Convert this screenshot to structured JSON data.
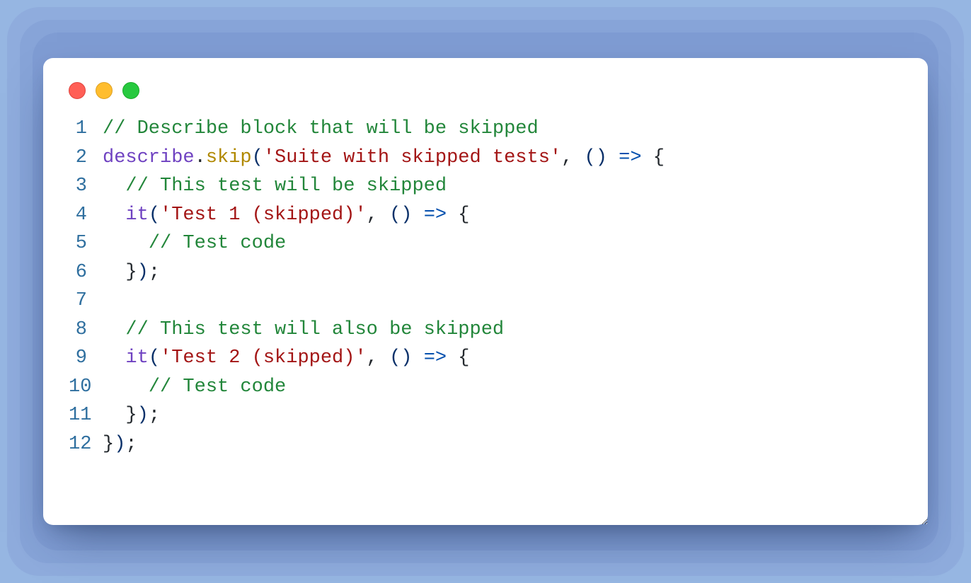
{
  "window": {
    "traffic": [
      "close",
      "minimize",
      "zoom"
    ]
  },
  "code": {
    "lines": [
      {
        "n": "1",
        "tokens": [
          {
            "cls": "c-comment",
            "t": "// Describe block that will be skipped"
          }
        ]
      },
      {
        "n": "2",
        "tokens": [
          {
            "cls": "c-call",
            "t": "describe"
          },
          {
            "cls": "c-punc",
            "t": "."
          },
          {
            "cls": "c-skip",
            "t": "skip"
          },
          {
            "cls": "c-paren",
            "t": "("
          },
          {
            "cls": "c-string",
            "t": "'Suite with skipped tests'"
          },
          {
            "cls": "c-punc",
            "t": ", "
          },
          {
            "cls": "c-paren",
            "t": "()"
          },
          {
            "cls": "c-punc",
            "t": " "
          },
          {
            "cls": "c-arrow",
            "t": "=>"
          },
          {
            "cls": "c-punc",
            "t": " "
          },
          {
            "cls": "c-brace",
            "t": "{"
          }
        ]
      },
      {
        "n": "3",
        "tokens": [
          {
            "cls": "",
            "t": "  "
          },
          {
            "cls": "c-comment",
            "t": "// This test will be skipped"
          }
        ]
      },
      {
        "n": "4",
        "tokens": [
          {
            "cls": "",
            "t": "  "
          },
          {
            "cls": "c-call",
            "t": "it"
          },
          {
            "cls": "c-paren",
            "t": "("
          },
          {
            "cls": "c-string",
            "t": "'Test 1 (skipped)'"
          },
          {
            "cls": "c-punc",
            "t": ", "
          },
          {
            "cls": "c-paren",
            "t": "()"
          },
          {
            "cls": "c-punc",
            "t": " "
          },
          {
            "cls": "c-arrow",
            "t": "=>"
          },
          {
            "cls": "c-punc",
            "t": " "
          },
          {
            "cls": "c-brace",
            "t": "{"
          }
        ]
      },
      {
        "n": "5",
        "tokens": [
          {
            "cls": "",
            "t": "    "
          },
          {
            "cls": "c-comment",
            "t": "// Test code"
          }
        ]
      },
      {
        "n": "6",
        "tokens": [
          {
            "cls": "",
            "t": "  "
          },
          {
            "cls": "c-brace",
            "t": "}"
          },
          {
            "cls": "c-paren",
            "t": ")"
          },
          {
            "cls": "c-punc",
            "t": ";"
          }
        ]
      },
      {
        "n": "7",
        "tokens": [
          {
            "cls": "",
            "t": ""
          }
        ]
      },
      {
        "n": "8",
        "tokens": [
          {
            "cls": "",
            "t": "  "
          },
          {
            "cls": "c-comment",
            "t": "// This test will also be skipped"
          }
        ]
      },
      {
        "n": "9",
        "tokens": [
          {
            "cls": "",
            "t": "  "
          },
          {
            "cls": "c-call",
            "t": "it"
          },
          {
            "cls": "c-paren",
            "t": "("
          },
          {
            "cls": "c-string",
            "t": "'Test 2 (skipped)'"
          },
          {
            "cls": "c-punc",
            "t": ", "
          },
          {
            "cls": "c-paren",
            "t": "()"
          },
          {
            "cls": "c-punc",
            "t": " "
          },
          {
            "cls": "c-arrow",
            "t": "=>"
          },
          {
            "cls": "c-punc",
            "t": " "
          },
          {
            "cls": "c-brace",
            "t": "{"
          }
        ]
      },
      {
        "n": "10",
        "tokens": [
          {
            "cls": "",
            "t": "    "
          },
          {
            "cls": "c-comment",
            "t": "// Test code"
          }
        ]
      },
      {
        "n": "11",
        "tokens": [
          {
            "cls": "",
            "t": "  "
          },
          {
            "cls": "c-brace",
            "t": "}"
          },
          {
            "cls": "c-paren",
            "t": ")"
          },
          {
            "cls": "c-punc",
            "t": ";"
          }
        ]
      },
      {
        "n": "12",
        "tokens": [
          {
            "cls": "c-brace",
            "t": "}"
          },
          {
            "cls": "c-paren",
            "t": ")"
          },
          {
            "cls": "c-punc",
            "t": ";"
          }
        ]
      }
    ]
  }
}
